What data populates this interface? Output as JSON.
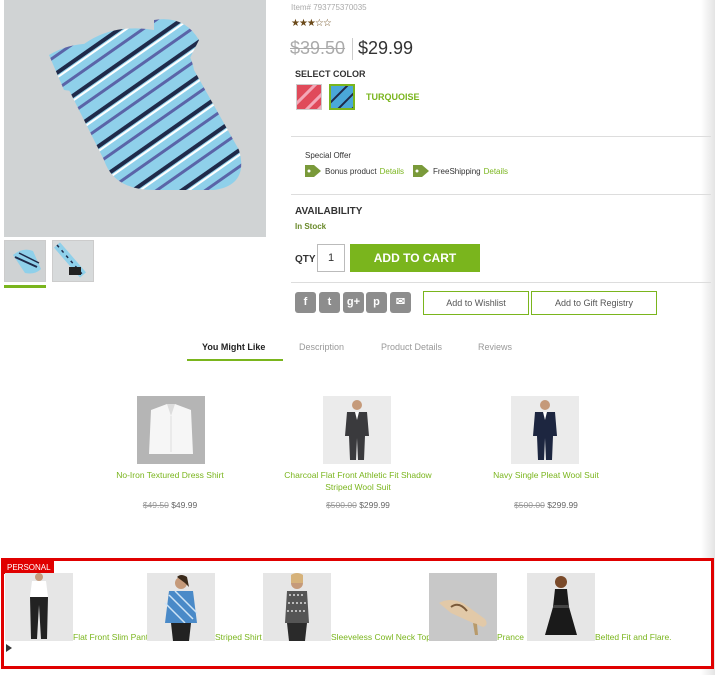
{
  "product": {
    "item_number": "Item# 793775370035",
    "rating_stars": "★★★☆☆",
    "price_old": "$39.50",
    "price_new": "$29.99",
    "select_color_label": "SELECT COLOR",
    "selected_color": "TURQUOISE",
    "special_offer_label": "Special Offer",
    "offers": [
      {
        "text": "Bonus product",
        "link": "Details"
      },
      {
        "text": "FreeShipping",
        "link": "Details"
      }
    ],
    "availability_label": "AVAILABILITY",
    "availability_status": "In Stock",
    "qty_label": "QTY",
    "qty_value": "1",
    "add_to_cart_label": "ADD TO CART",
    "wishlist_label": "Add to Wishlist",
    "registry_label": "Add to Gift Registry",
    "share_icons": [
      "f",
      "t",
      "g+",
      "p",
      "✉"
    ]
  },
  "tabs": [
    {
      "label": "You Might Like"
    },
    {
      "label": "Description"
    },
    {
      "label": "Product Details"
    },
    {
      "label": "Reviews"
    }
  ],
  "recommendations": [
    {
      "name": "No-Iron Textured Dress Shirt",
      "price_old": "$49.50",
      "price_new": "$49.99"
    },
    {
      "name": "Charcoal Flat Front Athletic Fit Shadow Striped Wool Suit",
      "price_old": "$500.00",
      "price_new": "$299.99"
    },
    {
      "name": "Navy Single Pleat Wool Suit",
      "price_old": "$500.00",
      "price_new": "$299.99"
    }
  ],
  "personal": {
    "badge": "PERSONAL",
    "items": [
      {
        "name": "Flat Front Slim Pant"
      },
      {
        "name": "Striped Shirt"
      },
      {
        "name": "Sleeveless Cowl Neck Top"
      },
      {
        "name": "Prance"
      },
      {
        "name": "Belted Fit and Flare."
      }
    ]
  },
  "colors": {
    "accent": "#7ab51d",
    "highlight_border": "#e00000",
    "tie_blue": "#8fd0ea"
  }
}
